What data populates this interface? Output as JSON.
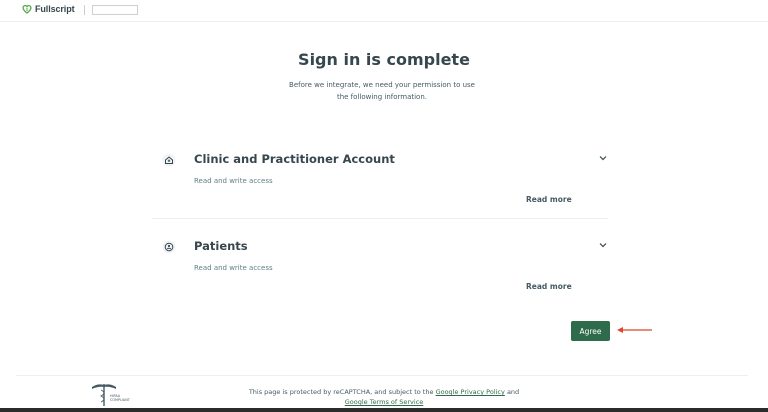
{
  "header": {
    "brand_name": "Fullscript",
    "brand_icon": "heart-leaf-icon",
    "brand_color": "#2e6b4a"
  },
  "main": {
    "title": "Sign in is complete",
    "subtitle_line1": "Before we integrate, we need your permission to use",
    "subtitle_line2": "the following information."
  },
  "permissions": [
    {
      "title": "Clinic and Practitioner Account",
      "access": "Read and write access",
      "read_more": "Read more",
      "icon": "clinic-icon"
    },
    {
      "title": "Patients",
      "access": "Read and write access",
      "read_more": "Read more",
      "icon": "patient-icon"
    }
  ],
  "actions": {
    "agree_label": "Agree",
    "accent_color": "#2e6b4a",
    "annotation_arrow_color": "#e0442b"
  },
  "footer": {
    "hipaa_line1": "HIPAA",
    "hipaa_line2": "COMPLIANT",
    "text_prefix": "This page is protected by reCAPTCHA, and subject to the",
    "privacy_link": "Google Privacy Policy",
    "and_text": "and",
    "terms_link": "Google Terms of Service"
  }
}
